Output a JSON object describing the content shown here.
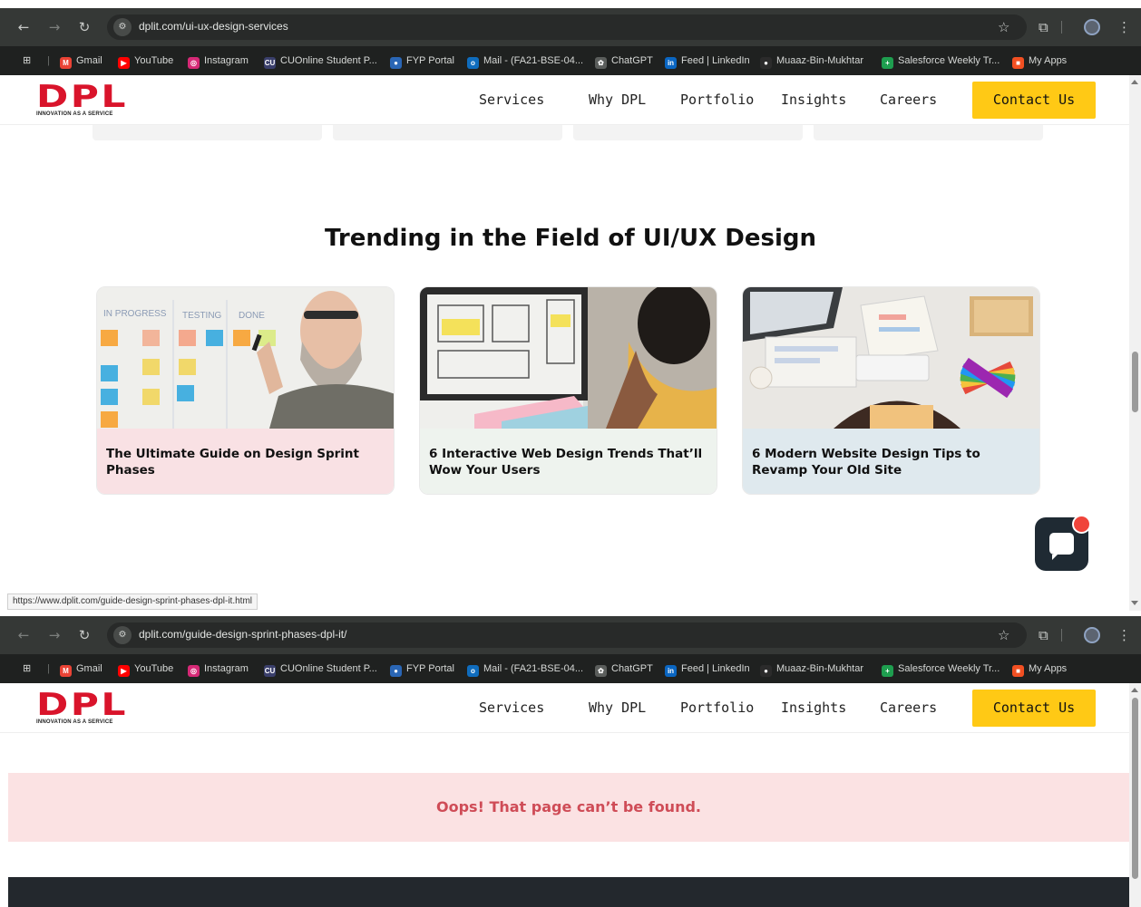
{
  "browser": {
    "tab1_url": "dplit.com/ui-ux-design-services",
    "tab2_url": "dplit.com/guide-design-sprint-phases-dpl-it/",
    "status_url": "https://www.dplit.com/guide-design-sprint-phases-dpl-it.html",
    "bookmarks": [
      {
        "label": "Gmail",
        "color": "#ea4335",
        "glyph": "M"
      },
      {
        "label": "YouTube",
        "color": "#ff0000",
        "glyph": "▶"
      },
      {
        "label": "Instagram",
        "color": "#d62976",
        "glyph": "◎"
      },
      {
        "label": "CUOnline Student P...",
        "color": "#3a3f6b",
        "glyph": "CU"
      },
      {
        "label": "FYP Portal",
        "color": "#2a66b5",
        "glyph": "●"
      },
      {
        "label": "Mail - (FA21-BSE-04...",
        "color": "#0f6cbd",
        "glyph": "o"
      },
      {
        "label": "ChatGPT",
        "color": "#5b5e5c",
        "glyph": "✿"
      },
      {
        "label": "Feed | LinkedIn",
        "color": "#0a66c2",
        "glyph": "in"
      },
      {
        "label": "Muaaz-Bin-Mukhtar",
        "color": "#2b2b2b",
        "glyph": "●"
      },
      {
        "label": "Salesforce Weekly Tr...",
        "color": "#1e9e4f",
        "glyph": "+"
      },
      {
        "label": "My Apps",
        "color": "#f25022",
        "glyph": "■"
      }
    ]
  },
  "site": {
    "logo": "DPL",
    "logo_tagline": "INNOVATION AS A SERVICE",
    "nav": [
      "Services",
      "Why DPL",
      "Portfolio",
      "Insights",
      "Careers"
    ],
    "contact_label": "Contact Us",
    "accent": "#ffc915",
    "brand_red": "#d9142b"
  },
  "trending": {
    "title": "Trending in the Field of UI/UX Design",
    "cards": [
      {
        "title": "The Ultimate Guide on Design Sprint Phases",
        "bg": "#f9e1e4",
        "board_labels": [
          "IN PROGRESS",
          "TESTING",
          "DONE"
        ]
      },
      {
        "title": "6 Interactive Web Design Trends That’ll Wow Your Users",
        "bg": "#eef3ee"
      },
      {
        "title": "6 Modern Website Design Tips to Revamp Your Old Site",
        "bg": "#dfe9ee"
      }
    ]
  },
  "error_page": {
    "message": "Oops! That page can’t be found."
  }
}
